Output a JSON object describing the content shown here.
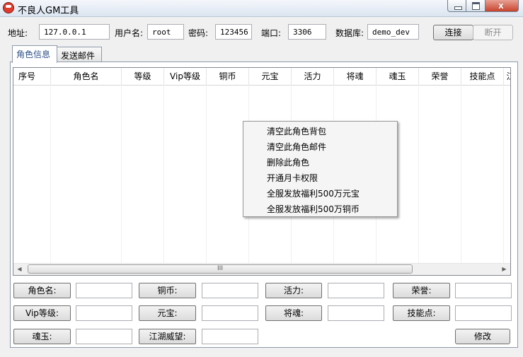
{
  "window": {
    "title": "不良人GM工具",
    "icon": "app-logo-icon",
    "close_glyph": "x"
  },
  "connection": {
    "address_label": "地址:",
    "address_value": "127.0.0.1",
    "user_label": "用户名:",
    "user_value": "root",
    "password_label": "密码:",
    "password_value": "123456",
    "port_label": "端口:",
    "port_value": "3306",
    "db_label": "数据库:",
    "db_value": "demo_dev",
    "connect_label": "连接",
    "disconnect_label": "断开"
  },
  "tabs": [
    {
      "label": "角色信息",
      "active": true
    },
    {
      "label": "发送邮件",
      "active": false
    }
  ],
  "table": {
    "columns": [
      "序号",
      "角色名",
      "等级",
      "Vip等级",
      "铜币",
      "元宝",
      "活力",
      "将魂",
      "魂玉",
      "荣誉",
      "技能点",
      "江"
    ],
    "rows": []
  },
  "scroll": {
    "left_arrow": "◀",
    "right_arrow": "▶",
    "thumb_grip": "III"
  },
  "context_menu": {
    "items": [
      "清空此角色背包",
      "清空此角色邮件",
      "删除此角色",
      "开通月卡权限",
      "全服发放福利500万元宝",
      "全服发放福利500万铜币"
    ]
  },
  "form": {
    "fields": [
      {
        "label": "角色名:",
        "value": ""
      },
      {
        "label": "铜币:",
        "value": ""
      },
      {
        "label": "活力:",
        "value": ""
      },
      {
        "label": "荣誉:",
        "value": ""
      },
      {
        "label": "Vip等级:",
        "value": ""
      },
      {
        "label": "元宝:",
        "value": ""
      },
      {
        "label": "将魂:",
        "value": ""
      },
      {
        "label": "技能点:",
        "value": ""
      },
      {
        "label": "魂玉:",
        "value": ""
      },
      {
        "label": "江湖威望:",
        "value": ""
      }
    ],
    "modify_label": "修改"
  }
}
